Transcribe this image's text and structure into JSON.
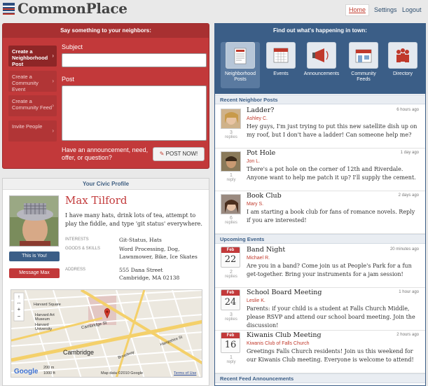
{
  "header": {
    "logo": "CommonPlace",
    "nav": [
      "Home",
      "Settings",
      "Logout"
    ]
  },
  "post_panel": {
    "title": "Say something to your neighbors:",
    "tabs": [
      "Create a Neighborhood Post",
      "Create a Community Event",
      "Create a Community Feed",
      "Invite People"
    ],
    "subject_label": "Subject",
    "post_label": "Post",
    "prompt": "Have an announcement, need, offer, or question?",
    "post_button": "POST NOW!"
  },
  "profile": {
    "title": "Your Civic Profile",
    "name": "Max Tilford",
    "bio": "I have many hats, drink lots of tea, attempt to play the fiddle, and type 'git status' everywhere.",
    "interests_label": "INTERESTS",
    "interests": "Git-Status, Hats",
    "goods_label": "GOODS & SKILLS",
    "goods": "Word Processing, Dog, Lawnmower, Bike, Ice Skates",
    "address_label": "ADDRESS",
    "address_line1": "555 Dana Street",
    "address_line2": "Cambridge, MA 02138",
    "this_is_you": "This is You!",
    "message": "Message Max"
  },
  "map": {
    "labels": {
      "street1": "Cambridge St",
      "street2": "Harvard Square",
      "street3": "Cambridge",
      "street4": "Broadway",
      "street5": "Hampshire St",
      "attr": "Map data ©2010 Google",
      "terms": "Terms of Use",
      "scale_m": "200 m",
      "scale_ft": "1000 ft",
      "logo": "Google",
      "poi1": "Harvard Art Museum",
      "poi2": "Harvard University"
    }
  },
  "town_panel": {
    "title": "Find out what's happening in town:",
    "icons": [
      "Neighborhood Posts",
      "Events",
      "Announcements",
      "Community Feeds",
      "Directory"
    ],
    "recent_posts_title": "Recent Neighbor Posts",
    "posts": [
      {
        "title": "Ladder?",
        "author": "Ashley C.",
        "time": "6 hours ago",
        "replies": "3",
        "replies_label": "replies",
        "body": "Hey guys, I'm just trying to put this new satellite dish up on my roof, but I don't have a ladder! Can someone help me?"
      },
      {
        "title": "Pot Hole",
        "author": "Jon L.",
        "time": "1 day ago",
        "replies": "1",
        "replies_label": "reply",
        "body": "There's a pot hole on the corner of 12th and Riverdale. Anyone want to help me patch it up? I'll supply the cement."
      },
      {
        "title": "Book Club",
        "author": "Mary S.",
        "time": "2 days ago",
        "replies": "6",
        "replies_label": "replies",
        "body": "I am starting a book club for fans of romance novels. Reply if you are interested!"
      }
    ],
    "events_title": "Upcoming Events",
    "events": [
      {
        "title": "Band Night",
        "author": "Michael R.",
        "time": "20 minutes ago",
        "month": "Feb",
        "day": "22",
        "replies": "2",
        "replies_label": "replies",
        "body": "Are you in a band? Come join us at People's Park for a fun get-together. Bring your instruments for a jam session!"
      },
      {
        "title": "School Board Meeting",
        "author": "Leslie K.",
        "time": "1 hour ago",
        "month": "Feb",
        "day": "24",
        "replies": "3",
        "replies_label": "replies",
        "body": "Parents: if your child is a student at Falls Church Middle, please RSVP and attend our school board meeting. Join the discussion!"
      },
      {
        "title": "Kiwanis Club Meeting",
        "author": "Kiwanis Club of Falls Church",
        "time": "2 hours ago",
        "month": "Feb",
        "day": "16",
        "replies": "1",
        "replies_label": "reply",
        "body": "Greetings Falls Church residents! Join us this weekend for our Kiwanis Club meeting. Everyone is welcome to attend!"
      }
    ],
    "feed_title": "Recent Feed Announcements"
  }
}
